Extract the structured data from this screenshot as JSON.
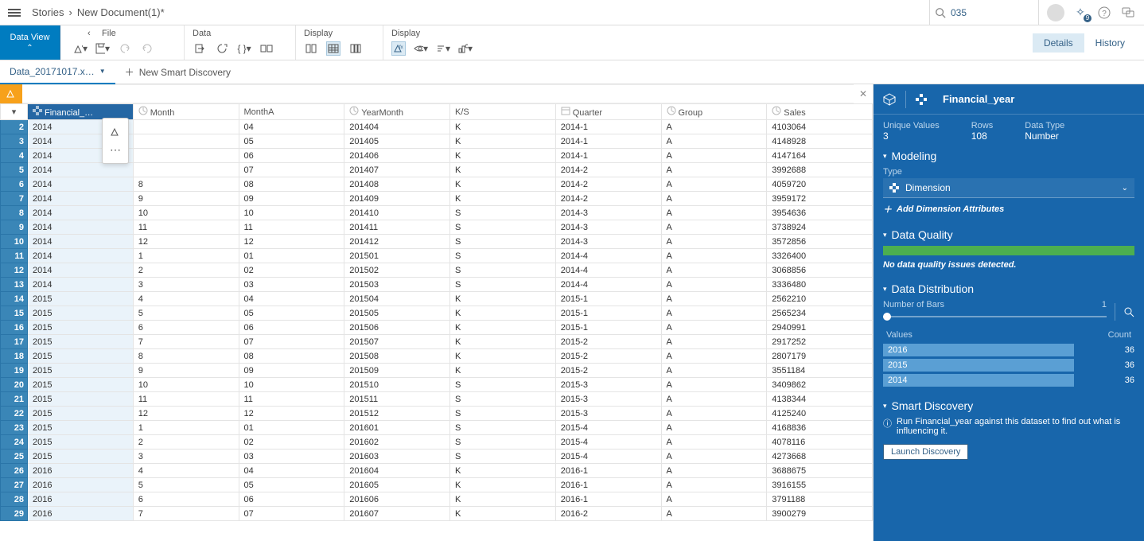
{
  "top": {
    "breadcrumb_root": "Stories",
    "breadcrumb_arrow": "›",
    "breadcrumb_doc": "New Document(1)*",
    "search_value": "035",
    "notif_badge": "9"
  },
  "ribbon": {
    "dv_label": "Data View",
    "groups": {
      "file": "File",
      "data": "Data",
      "display1": "Display",
      "display2": "Display"
    },
    "details_tab": "Details",
    "history_tab": "History"
  },
  "tabbar": {
    "file_tab": "Data_20171017.x…",
    "new_smart": "New Smart Discovery"
  },
  "columns": [
    {
      "key": "rownum",
      "label": ""
    },
    {
      "key": "Financial_year",
      "label": "Financial_…",
      "icon": "dim",
      "selected": true
    },
    {
      "key": "Month",
      "label": "Month",
      "icon": "meas"
    },
    {
      "key": "MonthA",
      "label": "MonthA"
    },
    {
      "key": "YearMonth",
      "label": "YearMonth",
      "icon": "meas"
    },
    {
      "key": "KS",
      "label": "K/S"
    },
    {
      "key": "Quarter",
      "label": "Quarter",
      "icon": "date"
    },
    {
      "key": "Group",
      "label": "Group",
      "icon": "meas"
    },
    {
      "key": "Sales",
      "label": "Sales",
      "icon": "meas"
    }
  ],
  "rows": [
    {
      "n": 2,
      "Financial_year": "2014",
      "Month": "",
      "MonthA": "04",
      "YearMonth": "201404",
      "KS": "K",
      "Quarter": "2014-1",
      "Group": "A",
      "Sales": "4103064"
    },
    {
      "n": 3,
      "Financial_year": "2014",
      "Month": "",
      "MonthA": "05",
      "YearMonth": "201405",
      "KS": "K",
      "Quarter": "2014-1",
      "Group": "A",
      "Sales": "4148928"
    },
    {
      "n": 4,
      "Financial_year": "2014",
      "Month": "",
      "MonthA": "06",
      "YearMonth": "201406",
      "KS": "K",
      "Quarter": "2014-1",
      "Group": "A",
      "Sales": "4147164"
    },
    {
      "n": 5,
      "Financial_year": "2014",
      "Month": "",
      "MonthA": "07",
      "YearMonth": "201407",
      "KS": "K",
      "Quarter": "2014-2",
      "Group": "A",
      "Sales": "3992688"
    },
    {
      "n": 6,
      "Financial_year": "2014",
      "Month": "8",
      "MonthA": "08",
      "YearMonth": "201408",
      "KS": "K",
      "Quarter": "2014-2",
      "Group": "A",
      "Sales": "4059720"
    },
    {
      "n": 7,
      "Financial_year": "2014",
      "Month": "9",
      "MonthA": "09",
      "YearMonth": "201409",
      "KS": "K",
      "Quarter": "2014-2",
      "Group": "A",
      "Sales": "3959172"
    },
    {
      "n": 8,
      "Financial_year": "2014",
      "Month": "10",
      "MonthA": "10",
      "YearMonth": "201410",
      "KS": "S",
      "Quarter": "2014-3",
      "Group": "A",
      "Sales": "3954636"
    },
    {
      "n": 9,
      "Financial_year": "2014",
      "Month": "11",
      "MonthA": "11",
      "YearMonth": "201411",
      "KS": "S",
      "Quarter": "2014-3",
      "Group": "A",
      "Sales": "3738924"
    },
    {
      "n": 10,
      "Financial_year": "2014",
      "Month": "12",
      "MonthA": "12",
      "YearMonth": "201412",
      "KS": "S",
      "Quarter": "2014-3",
      "Group": "A",
      "Sales": "3572856"
    },
    {
      "n": 11,
      "Financial_year": "2014",
      "Month": "1",
      "MonthA": "01",
      "YearMonth": "201501",
      "KS": "S",
      "Quarter": "2014-4",
      "Group": "A",
      "Sales": "3326400"
    },
    {
      "n": 12,
      "Financial_year": "2014",
      "Month": "2",
      "MonthA": "02",
      "YearMonth": "201502",
      "KS": "S",
      "Quarter": "2014-4",
      "Group": "A",
      "Sales": "3068856"
    },
    {
      "n": 13,
      "Financial_year": "2014",
      "Month": "3",
      "MonthA": "03",
      "YearMonth": "201503",
      "KS": "S",
      "Quarter": "2014-4",
      "Group": "A",
      "Sales": "3336480"
    },
    {
      "n": 14,
      "Financial_year": "2015",
      "Month": "4",
      "MonthA": "04",
      "YearMonth": "201504",
      "KS": "K",
      "Quarter": "2015-1",
      "Group": "A",
      "Sales": "2562210"
    },
    {
      "n": 15,
      "Financial_year": "2015",
      "Month": "5",
      "MonthA": "05",
      "YearMonth": "201505",
      "KS": "K",
      "Quarter": "2015-1",
      "Group": "A",
      "Sales": "2565234"
    },
    {
      "n": 16,
      "Financial_year": "2015",
      "Month": "6",
      "MonthA": "06",
      "YearMonth": "201506",
      "KS": "K",
      "Quarter": "2015-1",
      "Group": "A",
      "Sales": "2940991"
    },
    {
      "n": 17,
      "Financial_year": "2015",
      "Month": "7",
      "MonthA": "07",
      "YearMonth": "201507",
      "KS": "K",
      "Quarter": "2015-2",
      "Group": "A",
      "Sales": "2917252"
    },
    {
      "n": 18,
      "Financial_year": "2015",
      "Month": "8",
      "MonthA": "08",
      "YearMonth": "201508",
      "KS": "K",
      "Quarter": "2015-2",
      "Group": "A",
      "Sales": "2807179"
    },
    {
      "n": 19,
      "Financial_year": "2015",
      "Month": "9",
      "MonthA": "09",
      "YearMonth": "201509",
      "KS": "K",
      "Quarter": "2015-2",
      "Group": "A",
      "Sales": "3551184"
    },
    {
      "n": 20,
      "Financial_year": "2015",
      "Month": "10",
      "MonthA": "10",
      "YearMonth": "201510",
      "KS": "S",
      "Quarter": "2015-3",
      "Group": "A",
      "Sales": "3409862"
    },
    {
      "n": 21,
      "Financial_year": "2015",
      "Month": "11",
      "MonthA": "11",
      "YearMonth": "201511",
      "KS": "S",
      "Quarter": "2015-3",
      "Group": "A",
      "Sales": "4138344"
    },
    {
      "n": 22,
      "Financial_year": "2015",
      "Month": "12",
      "MonthA": "12",
      "YearMonth": "201512",
      "KS": "S",
      "Quarter": "2015-3",
      "Group": "A",
      "Sales": "4125240"
    },
    {
      "n": 23,
      "Financial_year": "2015",
      "Month": "1",
      "MonthA": "01",
      "YearMonth": "201601",
      "KS": "S",
      "Quarter": "2015-4",
      "Group": "A",
      "Sales": "4168836"
    },
    {
      "n": 24,
      "Financial_year": "2015",
      "Month": "2",
      "MonthA": "02",
      "YearMonth": "201602",
      "KS": "S",
      "Quarter": "2015-4",
      "Group": "A",
      "Sales": "4078116"
    },
    {
      "n": 25,
      "Financial_year": "2015",
      "Month": "3",
      "MonthA": "03",
      "YearMonth": "201603",
      "KS": "S",
      "Quarter": "2015-4",
      "Group": "A",
      "Sales": "4273668"
    },
    {
      "n": 26,
      "Financial_year": "2016",
      "Month": "4",
      "MonthA": "04",
      "YearMonth": "201604",
      "KS": "K",
      "Quarter": "2016-1",
      "Group": "A",
      "Sales": "3688675"
    },
    {
      "n": 27,
      "Financial_year": "2016",
      "Month": "5",
      "MonthA": "05",
      "YearMonth": "201605",
      "KS": "K",
      "Quarter": "2016-1",
      "Group": "A",
      "Sales": "3916155"
    },
    {
      "n": 28,
      "Financial_year": "2016",
      "Month": "6",
      "MonthA": "06",
      "YearMonth": "201606",
      "KS": "K",
      "Quarter": "2016-1",
      "Group": "A",
      "Sales": "3791188"
    },
    {
      "n": 29,
      "Financial_year": "2016",
      "Month": "7",
      "MonthA": "07",
      "YearMonth": "201607",
      "KS": "K",
      "Quarter": "2016-2",
      "Group": "A",
      "Sales": "3900279"
    }
  ],
  "sidepanel": {
    "field_name": "Financial_year",
    "unique_label": "Unique Values",
    "unique_val": "3",
    "rows_label": "Rows",
    "rows_val": "108",
    "dtype_label": "Data Type",
    "dtype_val": "Number",
    "modeling_title": "Modeling",
    "type_label": "Type",
    "type_value": "Dimension",
    "add_attr": "Add Dimension Attributes",
    "dq_title": "Data Quality",
    "dq_msg": "No data quality issues detected.",
    "dd_title": "Data Distribution",
    "nbars_label": "Number of Bars",
    "nbars_val": "1",
    "values_hdr": "Values",
    "count_hdr": "Count",
    "dist": [
      {
        "v": "2016",
        "c": "36"
      },
      {
        "v": "2015",
        "c": "36"
      },
      {
        "v": "2014",
        "c": "36"
      }
    ],
    "sd_title": "Smart Discovery",
    "sd_msg": "Run Financial_year against this dataset to find out what is influencing it.",
    "launch_btn": "Launch Discovery"
  }
}
